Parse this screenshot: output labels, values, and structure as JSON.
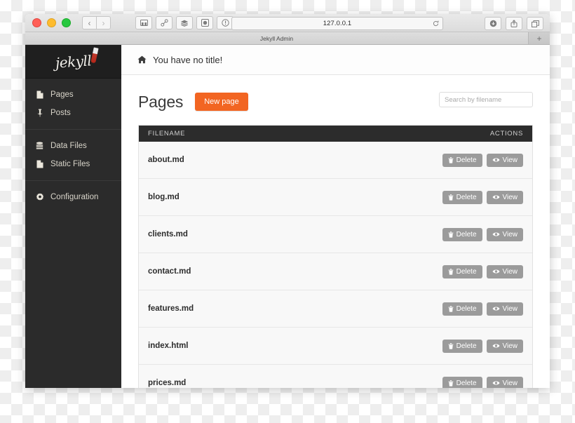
{
  "browser": {
    "url": "127.0.0.1",
    "tab_title": "Jekyll Admin",
    "back_glyph": "‹",
    "forward_glyph": "›",
    "reload_glyph": "↻",
    "newtab_glyph": "+",
    "toolbar_icons": [
      "sidebar-icon",
      "link-icon",
      "layers-icon",
      "camera-icon",
      "info-icon"
    ],
    "right_icons": [
      "download-icon",
      "share-icon",
      "tabs-icon"
    ]
  },
  "sidebar": {
    "logo_text": "jekyll",
    "groups": [
      {
        "items": [
          {
            "label": "Pages",
            "icon": "file-icon"
          },
          {
            "label": "Posts",
            "icon": "pin-icon"
          }
        ]
      },
      {
        "items": [
          {
            "label": "Data Files",
            "icon": "database-icon"
          },
          {
            "label": "Static Files",
            "icon": "file-icon"
          }
        ]
      },
      {
        "items": [
          {
            "label": "Configuration",
            "icon": "gear-icon"
          }
        ]
      }
    ]
  },
  "topbar": {
    "home_icon": "home-icon",
    "title": "You have no title!"
  },
  "page": {
    "title": "Pages",
    "new_button": "New page",
    "search_placeholder": "Search by filename",
    "search_value": ""
  },
  "table": {
    "headers": {
      "filename": "FILENAME",
      "actions": "ACTIONS"
    },
    "action_labels": {
      "delete": "Delete",
      "view": "View"
    },
    "rows": [
      {
        "filename": "about.md"
      },
      {
        "filename": "blog.md"
      },
      {
        "filename": "clients.md"
      },
      {
        "filename": "contact.md"
      },
      {
        "filename": "features.md"
      },
      {
        "filename": "index.html"
      },
      {
        "filename": "prices.md"
      }
    ]
  },
  "colors": {
    "accent": "#f26522",
    "sidebar": "#2b2b2b",
    "table_header": "#2c2c2c",
    "action_button": "#9b9b9b"
  }
}
